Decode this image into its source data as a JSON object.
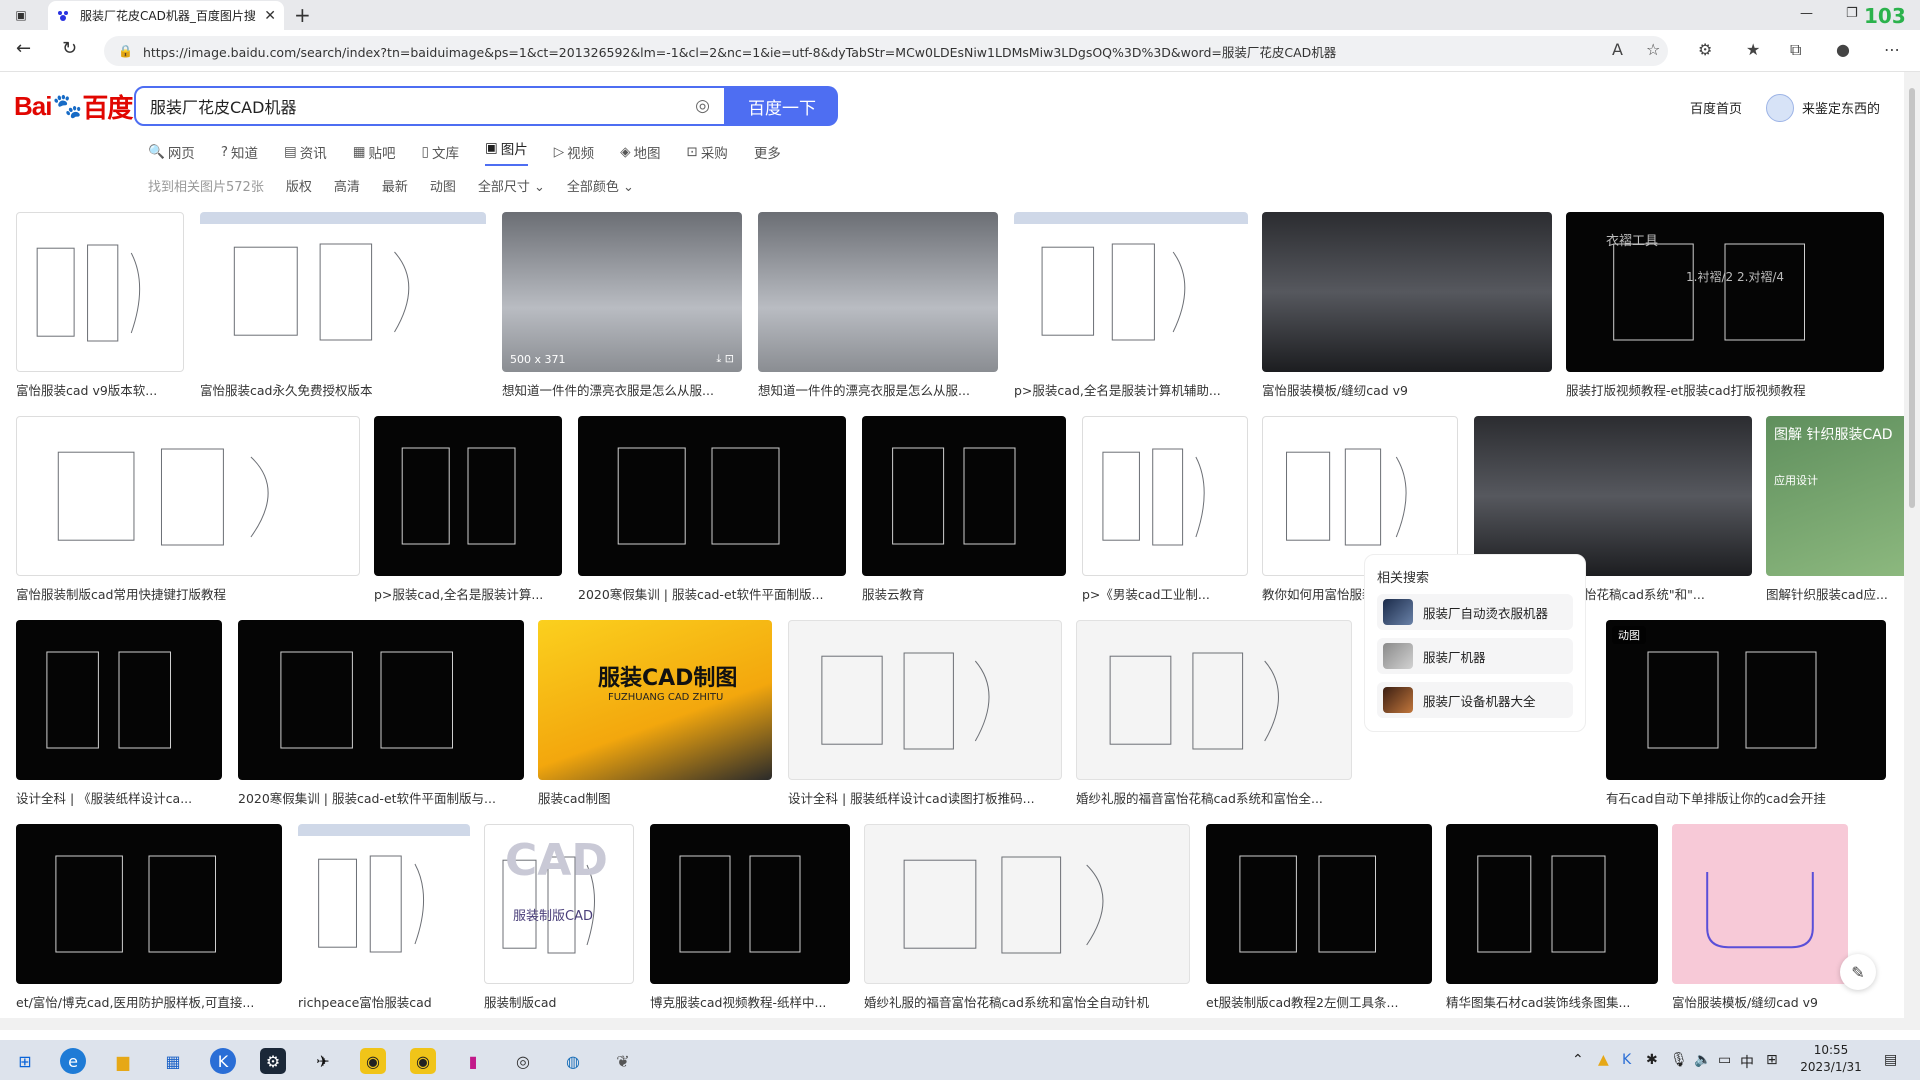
{
  "browser": {
    "tab_title": "服装厂花皮CAD机器_百度图片搜",
    "url": "https://image.baidu.com/search/index?tn=baiduimage&ps=1&ct=201326592&lm=-1&cl=2&nc=1&ie=utf-8&dyTabStr=MCw0LDEsNiw1LDMsMiw3LDgsOQ%3D%3D&word=服装厂花皮CAD机器",
    "corner_badge": "103"
  },
  "header": {
    "logo_bai": "Bai",
    "logo_paw": "🐾",
    "logo_du": "百度",
    "search_query": "服装厂花皮CAD机器",
    "search_button": "百度一下",
    "home_link": "百度首页",
    "username": "来鉴定东西的"
  },
  "nav_tabs": [
    {
      "icon": "🔍",
      "label": "网页"
    },
    {
      "icon": "?",
      "label": "知道"
    },
    {
      "icon": "▤",
      "label": "资讯"
    },
    {
      "icon": "▦",
      "label": "贴吧"
    },
    {
      "icon": "▯",
      "label": "文库"
    },
    {
      "icon": "▣",
      "label": "图片"
    },
    {
      "icon": "▷",
      "label": "视频"
    },
    {
      "icon": "◈",
      "label": "地图"
    },
    {
      "icon": "⊡",
      "label": "采购"
    },
    {
      "icon": "",
      "label": "更多"
    }
  ],
  "filters": {
    "count": "找到相关图片572张",
    "items": [
      "版权",
      "高清",
      "最新",
      "动图",
      "全部尺寸 ⌄",
      "全部颜色 ⌄"
    ]
  },
  "results": [
    {
      "caption": "富怡服装cad v9版本软...",
      "style": "white"
    },
    {
      "caption": "富怡服装cad永久免费授权版本",
      "style": "screen"
    },
    {
      "caption": "想知道一件件的漂亮衣服是怎么从服...",
      "style": "photo",
      "dims": "500 x 371"
    },
    {
      "caption": "想知道一件件的漂亮衣服是怎么从服...",
      "style": "photo"
    },
    {
      "caption": "p>服装cad,全名是服装计算机辅助...",
      "style": "screen"
    },
    {
      "caption": "富怡服装模板/缝纫cad v9",
      "style": "photo2"
    },
    {
      "caption": "服装打版视频教程-et服装cad打版视频教程",
      "style": "black"
    },
    {
      "caption": "富怡服装制版cad常用快捷键打版教程",
      "style": "white"
    },
    {
      "caption": "p>服装cad,全名是服装计算...",
      "style": "black"
    },
    {
      "caption": "2020寒假集训 | 服装cad-et软件平面制版...",
      "style": "black"
    },
    {
      "caption": "服装云教育",
      "style": "black"
    },
    {
      "caption": "p>《男装cad工业制...",
      "style": "white"
    },
    {
      "caption": "教你如何用富怡服装cad画男...",
      "style": "white"
    },
    {
      "caption": "婚纱礼服的福音|\"富怡花稿cad系统\"和\"...",
      "style": "photo2"
    },
    {
      "caption": "图解针织服装cad应...",
      "style": "green"
    },
    {
      "caption": "设计全科 | 《服装纸样设计ca...",
      "style": "black"
    },
    {
      "caption": "2020寒假集训 | 服装cad-et软件平面制版与...",
      "style": "black"
    },
    {
      "caption": "服装cad制图",
      "style": "yellow"
    },
    {
      "caption": "设计全科 | 服装纸样设计cad读图打板推码...",
      "style": "lightgray"
    },
    {
      "caption": "婚纱礼服的福音富怡花稿cad系统和富怡全...",
      "style": "lightgray"
    },
    {
      "caption": "有石cad自动下单排版让你的cad会开挂",
      "style": "black"
    },
    {
      "caption": "et/富怡/博克cad,医用防护服样板,可直接...",
      "style": "black"
    },
    {
      "caption": "richpeace富怡服装cad",
      "style": "screen"
    },
    {
      "caption": "服装制版cad",
      "style": "white"
    },
    {
      "caption": "博克服装cad视频教程-纸样中...",
      "style": "black"
    },
    {
      "caption": "婚纱礼服的福音富怡花稿cad系统和富怡全自动针机",
      "style": "lightgray"
    },
    {
      "caption": "et服装制版cad教程2左侧工具条...",
      "style": "black"
    },
    {
      "caption": "精华图集石材cad装饰线条图集...",
      "style": "black"
    },
    {
      "caption": "富怡服装模板/缝纫cad v9",
      "style": "pink"
    }
  ],
  "overlay_texts": {
    "yellow_title": "服装CAD制图",
    "yellow_sub": "FUZHUANG CAD ZHITU",
    "green_title": "图解 针织服装CAD",
    "green_sub": "应用设计",
    "anim_badge": "动图",
    "black_text1": "衣褶工具",
    "black_text2": "1.衬褶/2  2.对褶/4",
    "cad_logo": "CAD",
    "cad_sub": "服装制版CAD"
  },
  "related": {
    "title": "相关搜索",
    "items": [
      "服装厂自动烫衣服机器",
      "服装厂机器",
      "服装厂设备机器大全"
    ]
  },
  "taskbar": {
    "time": "10:55",
    "date": "2023/1/31",
    "ime": "中"
  }
}
